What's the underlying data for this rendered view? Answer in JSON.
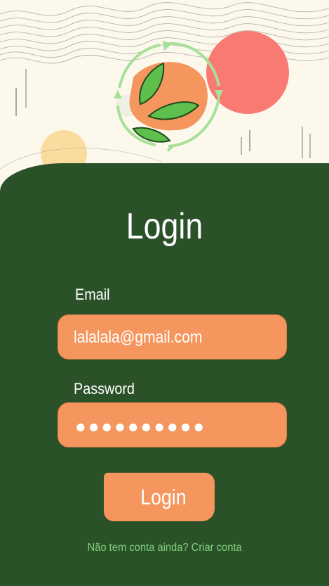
{
  "login": {
    "title": "Login",
    "email_label": "Email",
    "email_value": "lalalala@gmail.com",
    "password_label": "Password",
    "password_mask": "●●●●●●●●●●",
    "submit_label": "Login",
    "signup_link": "Não tem conta ainda? Criar conta"
  },
  "colors": {
    "background": "#fdf8ec",
    "panel": "#2b5129",
    "accent": "#f4965e",
    "link": "#7fd07a",
    "sun": "#f97a72"
  },
  "icons": {
    "hero": "recycle-leaf-fruit-icon"
  }
}
